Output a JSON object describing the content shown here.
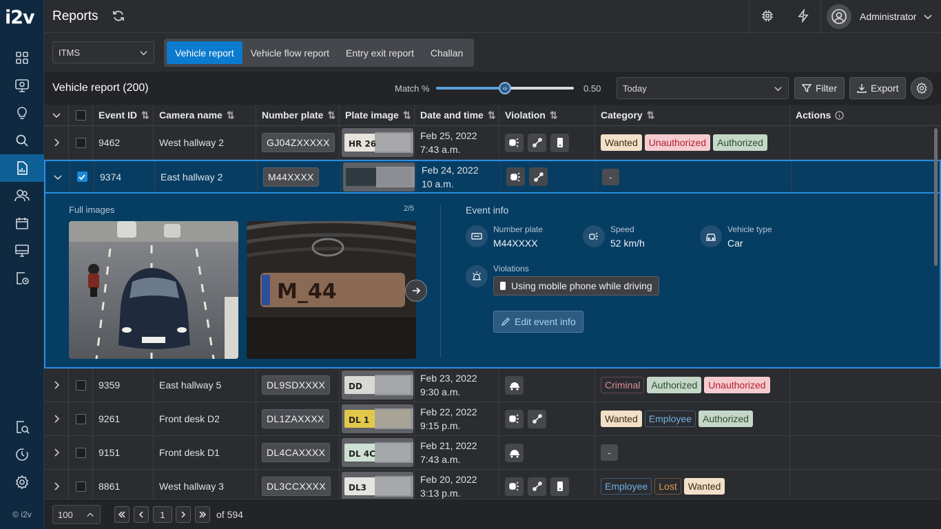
{
  "app": {
    "logo": "i2v",
    "copyright": "© i2v",
    "page_title": "Reports",
    "user": "Administrator"
  },
  "subbar": {
    "system_select": "ITMS",
    "tabs": [
      "Vehicle report",
      "Vehicle flow report",
      "Entry exit report",
      "Challan"
    ],
    "active_tab": 0
  },
  "header": {
    "title": "Vehicle report (200)",
    "match_label": "Match %",
    "match_value": "0.50",
    "match_fraction": 0.5,
    "date_select": "Today",
    "filter_label": "Filter",
    "export_label": "Export"
  },
  "columns": [
    "Event ID",
    "Camera name",
    "Number plate",
    "Plate image",
    "Date and time",
    "Violation",
    "Category",
    "Actions"
  ],
  "rows": [
    {
      "id": "9462",
      "camera": "West hallway 2",
      "plate": "GJ04ZXXXXX",
      "plate_text": "HR 26",
      "date": "Feb 25, 2022",
      "time": "7:43 a.m.",
      "violations": [
        "speed",
        "seatbelt",
        "phone"
      ],
      "tags": [
        [
          "Wanted",
          "wanted"
        ],
        [
          "Unauthorized",
          "unauth"
        ],
        [
          "Authorized",
          "auth"
        ]
      ],
      "checked": false,
      "expanded": false
    },
    {
      "id": "9374",
      "camera": "East hallway 2",
      "plate": "M44XXXX",
      "plate_text": "",
      "date": "Feb 24, 2022",
      "time": "10 a.m.",
      "violations": [
        "speed",
        "seatbelt"
      ],
      "tags": [
        [
          "-",
          "dash"
        ]
      ],
      "checked": true,
      "expanded": true
    },
    {
      "id": "9359",
      "camera": "East hallway 5",
      "plate": "DL9SDXXXX",
      "plate_text": "DD",
      "date": "Feb 23, 2022",
      "time": "9:30 a.m.",
      "violations": [
        "helmet"
      ],
      "tags": [
        [
          "Criminal",
          "crim"
        ],
        [
          "Authorized",
          "auth"
        ],
        [
          "Unauthorized",
          "unauth"
        ]
      ],
      "checked": false,
      "expanded": false
    },
    {
      "id": "9261",
      "camera": "Front desk D2",
      "plate": "DL1ZAXXXX",
      "plate_text": "DL 1",
      "date": "Feb 22, 2022",
      "time": "9:15 p.m.",
      "violations": [
        "speed",
        "seatbelt"
      ],
      "tags": [
        [
          "Wanted",
          "wanted"
        ],
        [
          "Employee",
          "emp"
        ],
        [
          "Authorized",
          "auth"
        ]
      ],
      "checked": false,
      "expanded": false
    },
    {
      "id": "9151",
      "camera": "Front desk D1",
      "plate": "DL4CAXXXX",
      "plate_text": "DL 4C",
      "date": "Feb 21, 2022",
      "time": "7:43 a.m.",
      "violations": [
        "helmet"
      ],
      "tags": [
        [
          "-",
          "dash"
        ]
      ],
      "checked": false,
      "expanded": false
    },
    {
      "id": "8861",
      "camera": "West hallway 3",
      "plate": "DL3CCXXXX",
      "plate_text": "DL3",
      "date": "Feb 20, 2022",
      "time": "3:13 p.m.",
      "violations": [
        "speed",
        "seatbelt",
        "phone"
      ],
      "tags": [
        [
          "Employee",
          "emp"
        ],
        [
          "Lost",
          "lost"
        ],
        [
          "Wanted",
          "wanted"
        ]
      ],
      "checked": false,
      "expanded": false
    }
  ],
  "details": {
    "full_images_label": "Full images",
    "counter": "2/5",
    "plate_closeup": "M_44",
    "event_info_label": "Event info",
    "number_plate_label": "Number plate",
    "number_plate": "M44XXXX",
    "speed_label": "Speed",
    "speed": "52 km/h",
    "vehicle_type_label": "Vehicle type",
    "vehicle_type": "Car",
    "violations_label": "Violations",
    "violation": "Using mobile phone while driving",
    "edit_label": "Edit event info"
  },
  "footer": {
    "page_size": "100",
    "page": "1",
    "of": "of 594"
  },
  "colors": {
    "accent": "#0b7bcf",
    "sidebar": "#0e2940",
    "selected": "#063d63"
  }
}
